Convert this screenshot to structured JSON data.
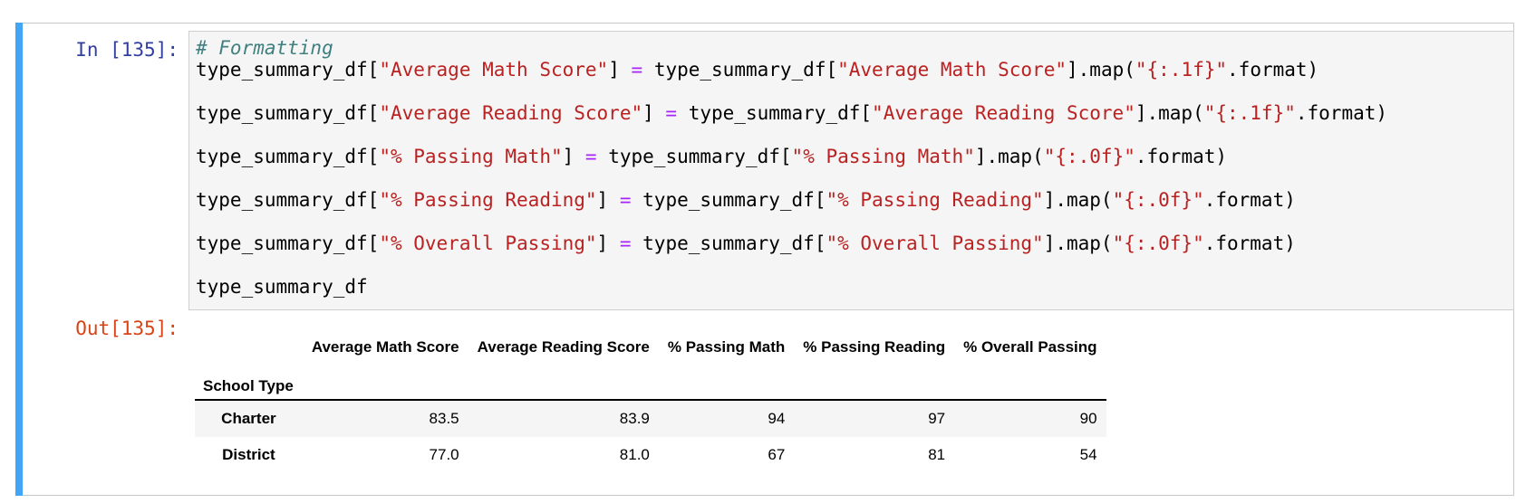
{
  "notebook": {
    "input_prompt": "In [135]:",
    "output_prompt": "Out[135]:",
    "code_lines": [
      {
        "type": "comment",
        "text": "# Formatting"
      },
      {
        "type": "assign",
        "col": "\"Average Math Score\"",
        "fmt": "\"{:.1f}\""
      },
      {
        "type": "assign",
        "col": "\"Average Reading Score\"",
        "fmt": "\"{:.1f}\""
      },
      {
        "type": "assign",
        "col": "\"% Passing Math\"",
        "fmt": "\"{:.0f}\""
      },
      {
        "type": "assign",
        "col": "\"% Passing Reading\"",
        "fmt": "\"{:.0f}\""
      },
      {
        "type": "assign",
        "col": "\"% Overall Passing\"",
        "fmt": "\"{:.0f}\""
      },
      {
        "type": "plain",
        "text": "type_summary_df"
      }
    ],
    "code_tokens": {
      "df_name": "type_summary_df",
      "lbracket": "[",
      "rbracket": "]",
      "eq": "=",
      "map_open": ".map(",
      "format_close": ".format)"
    },
    "output_table": {
      "columns": [
        "Average Math Score",
        "Average Reading Score",
        "% Passing Math",
        "% Passing Reading",
        "% Overall Passing"
      ],
      "index_name": "School Type",
      "rows": [
        {
          "index": "Charter",
          "values": [
            "83.5",
            "83.9",
            "94",
            "97",
            "90"
          ]
        },
        {
          "index": "District",
          "values": [
            "77.0",
            "81.0",
            "67",
            "81",
            "54"
          ]
        }
      ]
    }
  },
  "colors": {
    "accent_bar": "#42a5f5",
    "prompt_in": "#303f9f",
    "prompt_out": "#d84315",
    "string": "#ba2121",
    "operator": "#aa22ff",
    "comment": "#408080"
  }
}
